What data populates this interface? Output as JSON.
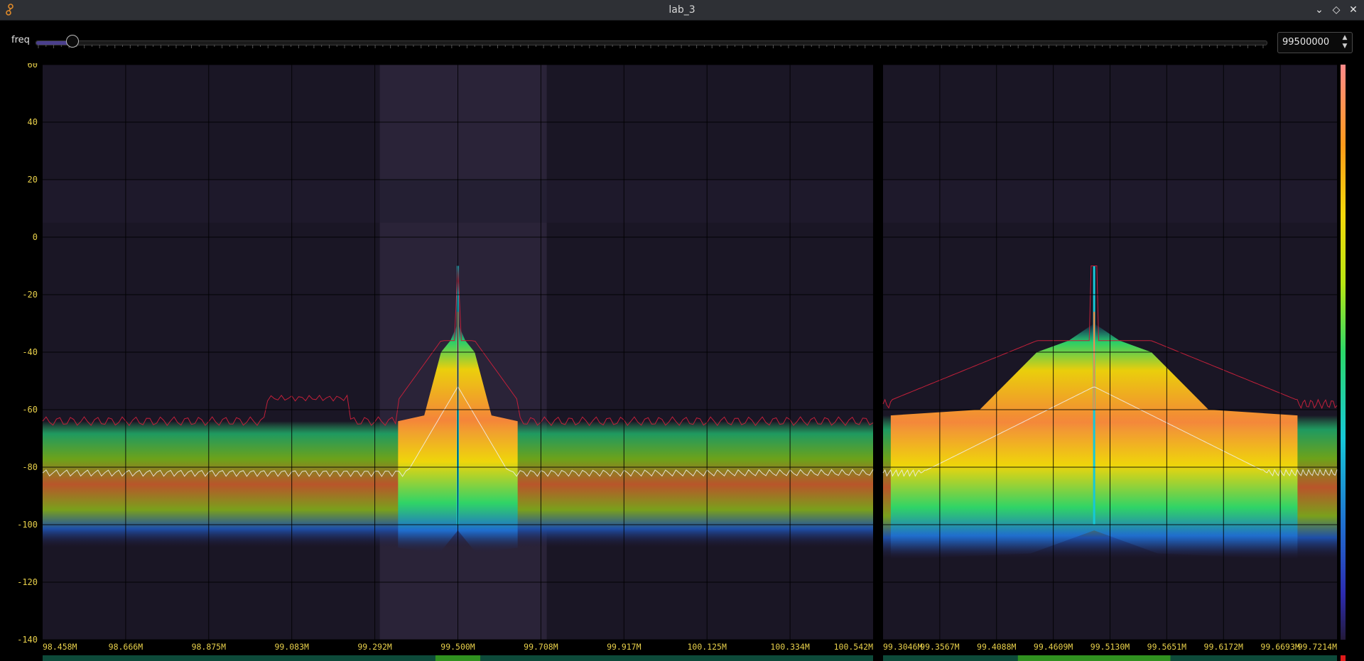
{
  "window": {
    "title": "lab_3",
    "buttons": {
      "minimize": "⌄",
      "maximize": "◇",
      "close": "✕"
    }
  },
  "controls": {
    "slider_label": "freq",
    "freq_value": "99500000",
    "slider_position": 0.02
  },
  "y_axis": {
    "labels": [
      "60",
      "40",
      "20",
      "0",
      "-20",
      "-40",
      "-60",
      "-80",
      "-100",
      "-120",
      "-140"
    ],
    "range": [
      -140,
      60
    ]
  },
  "left_panel": {
    "x_labels": [
      "98.458M",
      "98.666M",
      "98.875M",
      "99.083M",
      "99.292M",
      "99.500M",
      "99.708M",
      "99.917M",
      "100.125M",
      "100.334M",
      "100.542M"
    ],
    "center_freq_label": "99.500M"
  },
  "right_panel": {
    "x_labels": [
      "99.3046M",
      "99.3567M",
      "99.4088M",
      "99.4609M",
      "99.5130M",
      "99.5651M",
      "99.6172M",
      "99.6693M",
      "99.7214M"
    ]
  },
  "colors": {
    "axis_label": "#e7cf4a",
    "background": "#1a1625",
    "highlight_band": "#2a2338",
    "accent": "#4a3f8c",
    "colormap": [
      "#231a3a",
      "#2c2bb0",
      "#1f6fd0",
      "#16c8d8",
      "#2bd86a",
      "#b8e612",
      "#f5d80a",
      "#ff9a1a",
      "#ff6a3a",
      "#ff8a8a"
    ]
  }
}
